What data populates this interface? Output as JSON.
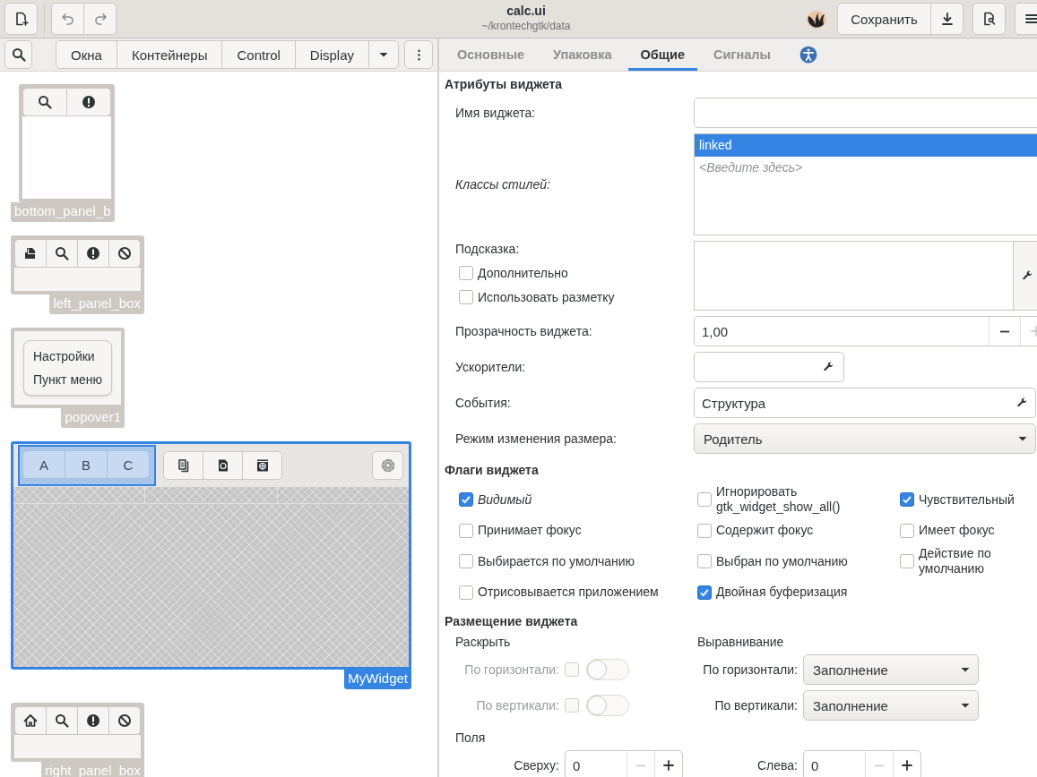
{
  "header": {
    "title": "calc.ui",
    "subtitle": "~/krontechgtk/data",
    "save_label": "Сохранить"
  },
  "palette": {
    "groups": [
      {
        "label": "Окна"
      },
      {
        "label": "Контейнеры"
      },
      {
        "label": "Control"
      },
      {
        "label": "Display"
      }
    ]
  },
  "canvas": {
    "widgets": [
      {
        "kind": "panel",
        "label": "bottom_panel_b",
        "selected": false,
        "buttons": [
          {
            "kind": "search"
          },
          {
            "kind": "alert"
          }
        ]
      },
      {
        "kind": "strip",
        "label": "left_panel_box",
        "selected": false,
        "buttons": [
          {
            "kind": "paste"
          },
          {
            "kind": "search"
          },
          {
            "kind": "alert"
          },
          {
            "kind": "block"
          }
        ]
      },
      {
        "kind": "popover",
        "label": "popover1",
        "selected": false,
        "items": [
          "Настройки",
          "Пункт меню"
        ]
      },
      {
        "kind": "custom",
        "label": "MyWidget",
        "selected": true,
        "linked_selected": true,
        "linked": [
          {
            "label": "A"
          },
          {
            "label": "B"
          },
          {
            "label": "C"
          }
        ],
        "buttons": [
          {
            "kind": "pages"
          },
          {
            "kind": "disc"
          },
          {
            "kind": "film"
          }
        ]
      },
      {
        "kind": "strip",
        "label": "right_panel_box",
        "selected": false,
        "buttons": [
          {
            "kind": "home"
          },
          {
            "kind": "search"
          },
          {
            "kind": "alert"
          },
          {
            "kind": "block"
          }
        ]
      }
    ]
  },
  "editor": {
    "tabs": [
      {
        "kind": "text",
        "label": "Основные",
        "selected": false
      },
      {
        "kind": "text",
        "label": "Упаковка",
        "selected": false
      },
      {
        "kind": "text",
        "label": "Общие",
        "selected": true
      },
      {
        "kind": "text",
        "label": "Сигналы",
        "selected": false
      },
      {
        "kind": "icon",
        "selected": false
      }
    ],
    "attributes": {
      "title": "Атрибуты виджета",
      "name": {
        "label": "Имя виджета:"
      },
      "style_classes": {
        "label": "Классы стилей:",
        "items": [
          {
            "text": "linked",
            "selected": true
          }
        ],
        "placeholder": "<Введите здесь>"
      },
      "tooltip": {
        "label": "Подсказка:",
        "options": [
          {
            "label": "Дополнительно",
            "checked": false
          },
          {
            "label": "Использовать разметку",
            "checked": false
          }
        ]
      },
      "opacity": {
        "label": "Прозрачность виджета:",
        "value": "1,00",
        "decrement_disabled": false,
        "increment_disabled": true
      },
      "accelerators": {
        "label": "Ускорители:"
      },
      "events": {
        "label": "События:",
        "value": "Структура"
      },
      "resize_mode": {
        "label": "Режим изменения размера:",
        "value": "Родитель"
      }
    },
    "flags": {
      "title": "Флаги виджета",
      "items": [
        {
          "label": "Видимый",
          "checked": true,
          "italic": true
        },
        {
          "label": "Игнорировать gtk_widget_show_all()",
          "checked": false,
          "italic": false
        },
        {
          "label": "Чувствительный",
          "checked": true,
          "italic": false
        },
        {
          "label": "Принимает фокус",
          "checked": false,
          "italic": false
        },
        {
          "label": "Содержит фокус",
          "checked": false,
          "italic": false
        },
        {
          "label": "Имеет фокус",
          "checked": false,
          "italic": false
        },
        {
          "label": "Выбирается по умолчанию",
          "checked": false,
          "italic": false
        },
        {
          "label": "Выбран по умолчанию",
          "checked": false,
          "italic": false
        },
        {
          "label": "Действие по умолчанию",
          "checked": false,
          "italic": false
        },
        {
          "label": "Отрисовывается приложением",
          "checked": false,
          "italic": false
        },
        {
          "label": "Двойная буферизация",
          "checked": true,
          "italic": false
        }
      ]
    },
    "placement": {
      "title": "Размещение виджета",
      "expand": {
        "title": "Раскрыть",
        "rows": [
          {
            "label": "По горизонтали:",
            "checked": false,
            "on": false,
            "disabled": true
          },
          {
            "label": "По вертикали:",
            "checked": false,
            "on": false,
            "disabled": true
          }
        ]
      },
      "align": {
        "title": "Выравнивание",
        "rows": [
          {
            "label": "По горизонтали:",
            "value": "Заполнение"
          },
          {
            "label": "По вертикали:",
            "value": "Заполнение"
          }
        ]
      },
      "margins": {
        "title": "Поля",
        "rows": [
          {
            "label": "Сверху:",
            "value": "0",
            "decrement_disabled": true,
            "increment_disabled": false
          },
          {
            "label": "Слева:",
            "value": "0",
            "decrement_disabled": true,
            "increment_disabled": false
          }
        ]
      }
    }
  }
}
